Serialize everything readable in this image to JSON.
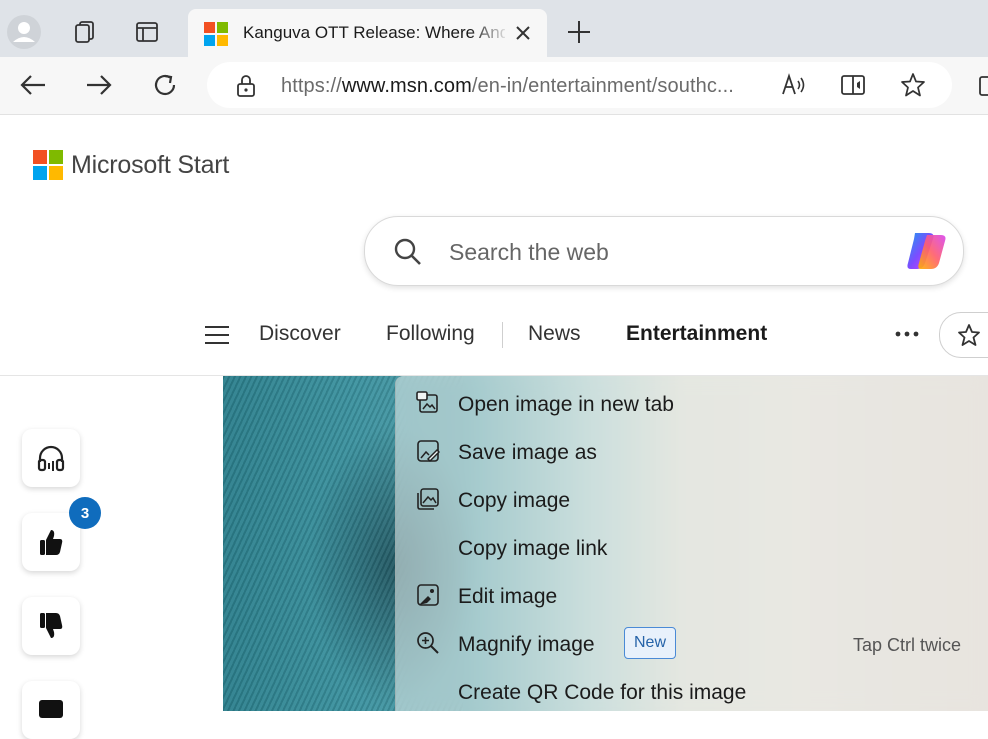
{
  "browser": {
    "tab_title": "Kanguva OTT Release: Where And When To Watch",
    "url_scheme": "https://",
    "url_domain": "www.msn.com",
    "url_path": "/en-in/entertainment/southc..."
  },
  "page": {
    "brand": "Microsoft Start",
    "search_placeholder": "Search the web",
    "nav": [
      "Discover",
      "Following",
      "News",
      "Entertainment"
    ],
    "like_count": "3"
  },
  "context_menu": {
    "items": [
      {
        "label": "Open image in new tab",
        "icon": "open-new-tab-icon"
      },
      {
        "label": "Save image as",
        "icon": "save-image-icon"
      },
      {
        "label": "Copy image",
        "icon": "copy-image-icon"
      },
      {
        "label": "Copy image link",
        "icon": ""
      },
      {
        "label": "Edit image",
        "icon": "edit-image-icon"
      },
      {
        "label": "Magnify image",
        "icon": "magnify-icon",
        "badge": "New",
        "shortcut": "Tap Ctrl twice"
      },
      {
        "label": "Create QR Code for this image",
        "icon": ""
      }
    ]
  },
  "colors": {
    "accent": "#0f6cbd",
    "tabstrip": "#dfe3e8",
    "toolbar": "#f7f7f7"
  }
}
